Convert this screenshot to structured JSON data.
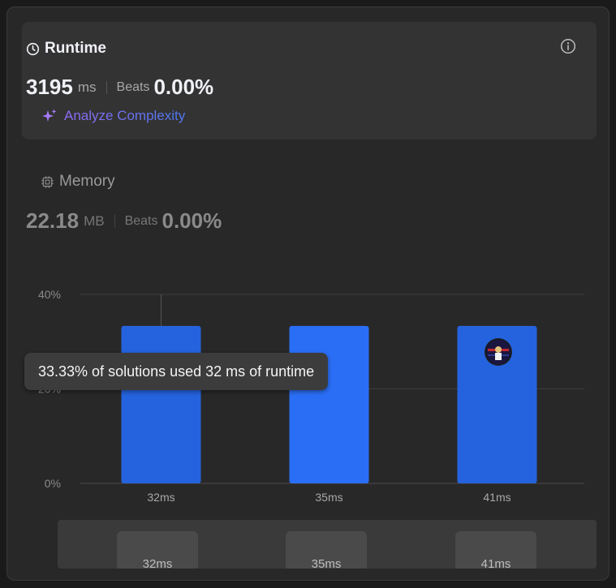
{
  "runtime": {
    "title": "Runtime",
    "value": "3195",
    "unit": "ms",
    "beats_label": "Beats",
    "beats_value": "0.00%",
    "analyze_label": "Analyze Complexity"
  },
  "memory": {
    "title": "Memory",
    "value": "22.18",
    "unit": "MB",
    "beats_label": "Beats",
    "beats_value": "0.00%"
  },
  "tooltip": "33.33% of solutions used 32 ms of runtime",
  "colors": {
    "bar": "#2b6ef6",
    "bar_active": "#2563de",
    "accent_purple": "#8f6cf5"
  },
  "chart_data": {
    "type": "bar",
    "categories": [
      "32ms",
      "35ms",
      "41ms"
    ],
    "values": [
      33.33,
      33.33,
      33.33
    ],
    "ylim": [
      0,
      40
    ],
    "yticks": [
      "0%",
      "20%",
      "40%"
    ],
    "grid": true
  },
  "range_slider": {
    "labels": [
      "32ms",
      "35ms",
      "41ms"
    ]
  },
  "icons": {
    "runtime": "clock-icon",
    "memory": "chip-icon",
    "info": "info-icon",
    "analyze": "sparkle-icon"
  }
}
